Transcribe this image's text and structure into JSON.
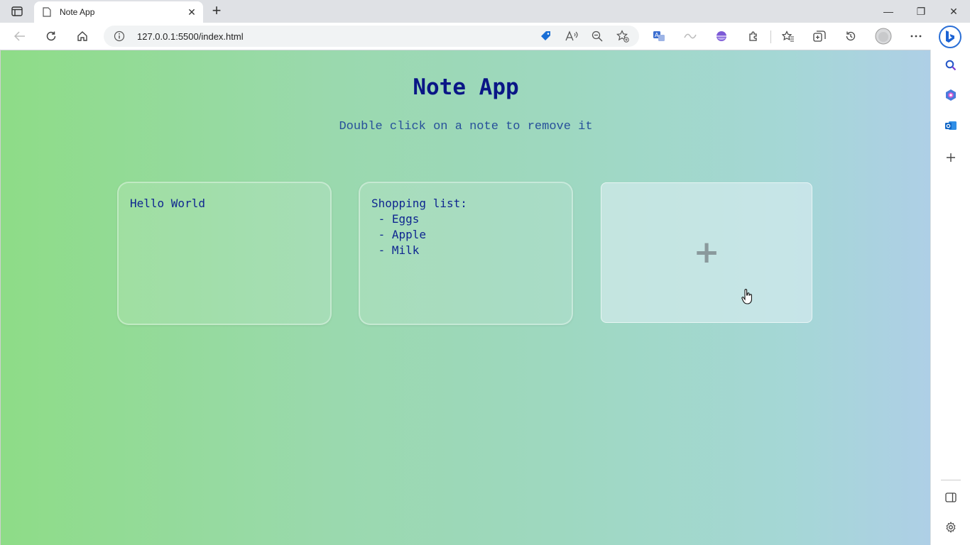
{
  "browser": {
    "tab_title": "Note App",
    "tab_close": "✕",
    "new_tab": "+",
    "url": "127.0.0.1:5500/index.html",
    "window_controls": {
      "minimize": "—",
      "restore": "❐",
      "close": "✕"
    }
  },
  "app": {
    "title": "Note App",
    "subtitle": "Double click on a note to remove it",
    "notes": [
      {
        "text": "Hello World"
      },
      {
        "text": "Shopping list:\n - Eggs\n - Apple\n - Milk"
      }
    ],
    "add_button_symbol": "+"
  },
  "colors": {
    "title": "#0a1686",
    "subtitle": "#27509a",
    "note_text": "#0f2690",
    "bg_start": "#8edc87",
    "bg_end": "#aecfe6"
  },
  "icons": [
    "tab-actions-icon",
    "page-icon",
    "back-icon",
    "refresh-icon",
    "home-icon",
    "info-icon",
    "shopping-tag-icon",
    "read-aloud-icon",
    "zoom-out-icon",
    "add-favorite-icon",
    "translate-icon",
    "extension-icon",
    "browser-essentials-icon",
    "extensions-icon",
    "favorites-icon",
    "collections-icon",
    "history-icon",
    "profile-icon",
    "more-icon",
    "bing-icon",
    "search-icon",
    "copilot-icon",
    "outlook-icon",
    "add-icon",
    "sidebar-toggle-icon",
    "settings-icon",
    "hand-cursor-icon"
  ]
}
